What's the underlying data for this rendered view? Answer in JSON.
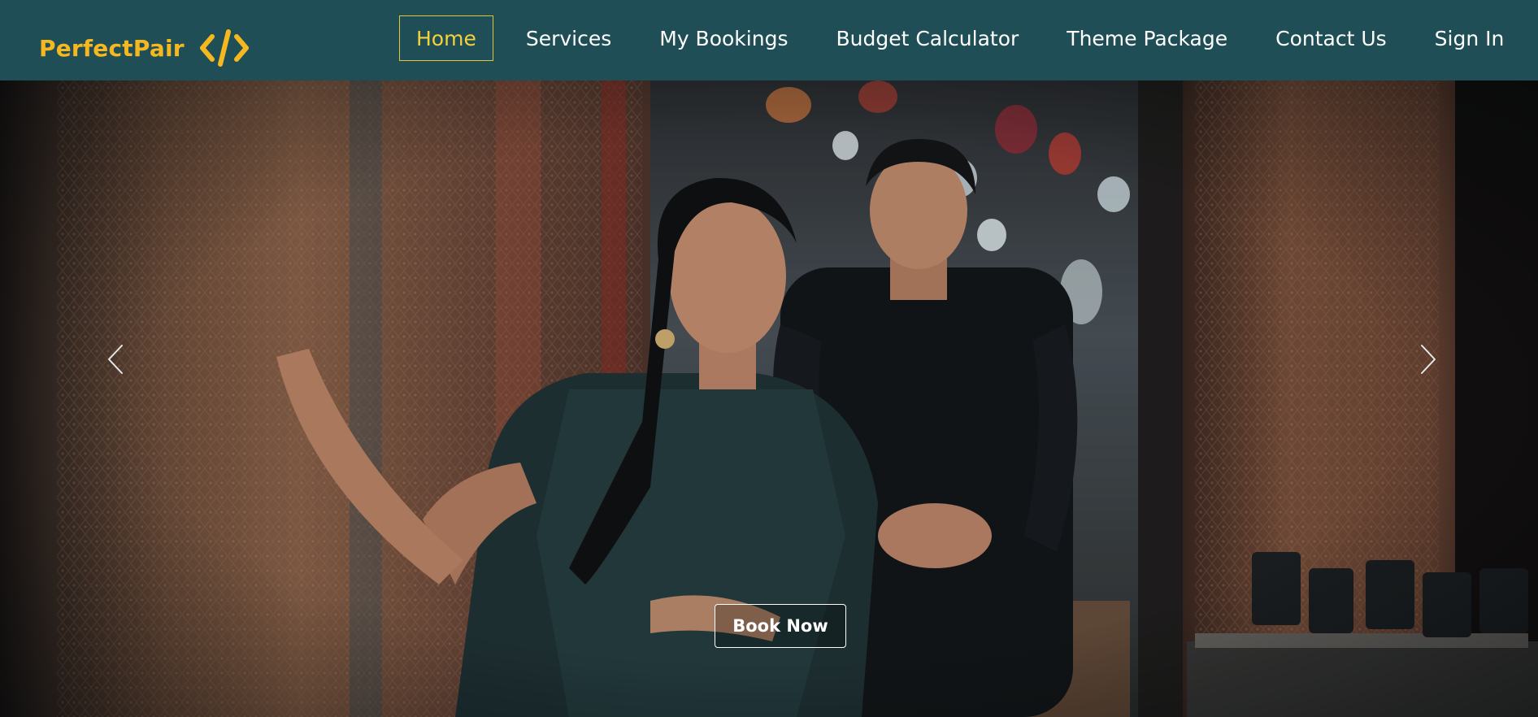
{
  "brand": {
    "name": "PerfectPair",
    "logo_icon": "code-brackets-icon",
    "color": "#f5b820"
  },
  "nav": {
    "items": [
      {
        "label": "Home",
        "active": true
      },
      {
        "label": "Services",
        "active": false
      },
      {
        "label": "My Bookings",
        "active": false
      },
      {
        "label": "Budget Calculator",
        "active": false
      },
      {
        "label": "Theme Package",
        "active": false
      },
      {
        "label": "Contact Us",
        "active": false
      },
      {
        "label": "Sign In",
        "active": false
      }
    ],
    "background": "#1f4e56",
    "active_color": "#f5d13a"
  },
  "hero": {
    "image": "couple-in-carpet-shop-photo",
    "prev_icon": "chevron-left-icon",
    "next_icon": "chevron-right-icon",
    "cta_label": "Book Now"
  }
}
